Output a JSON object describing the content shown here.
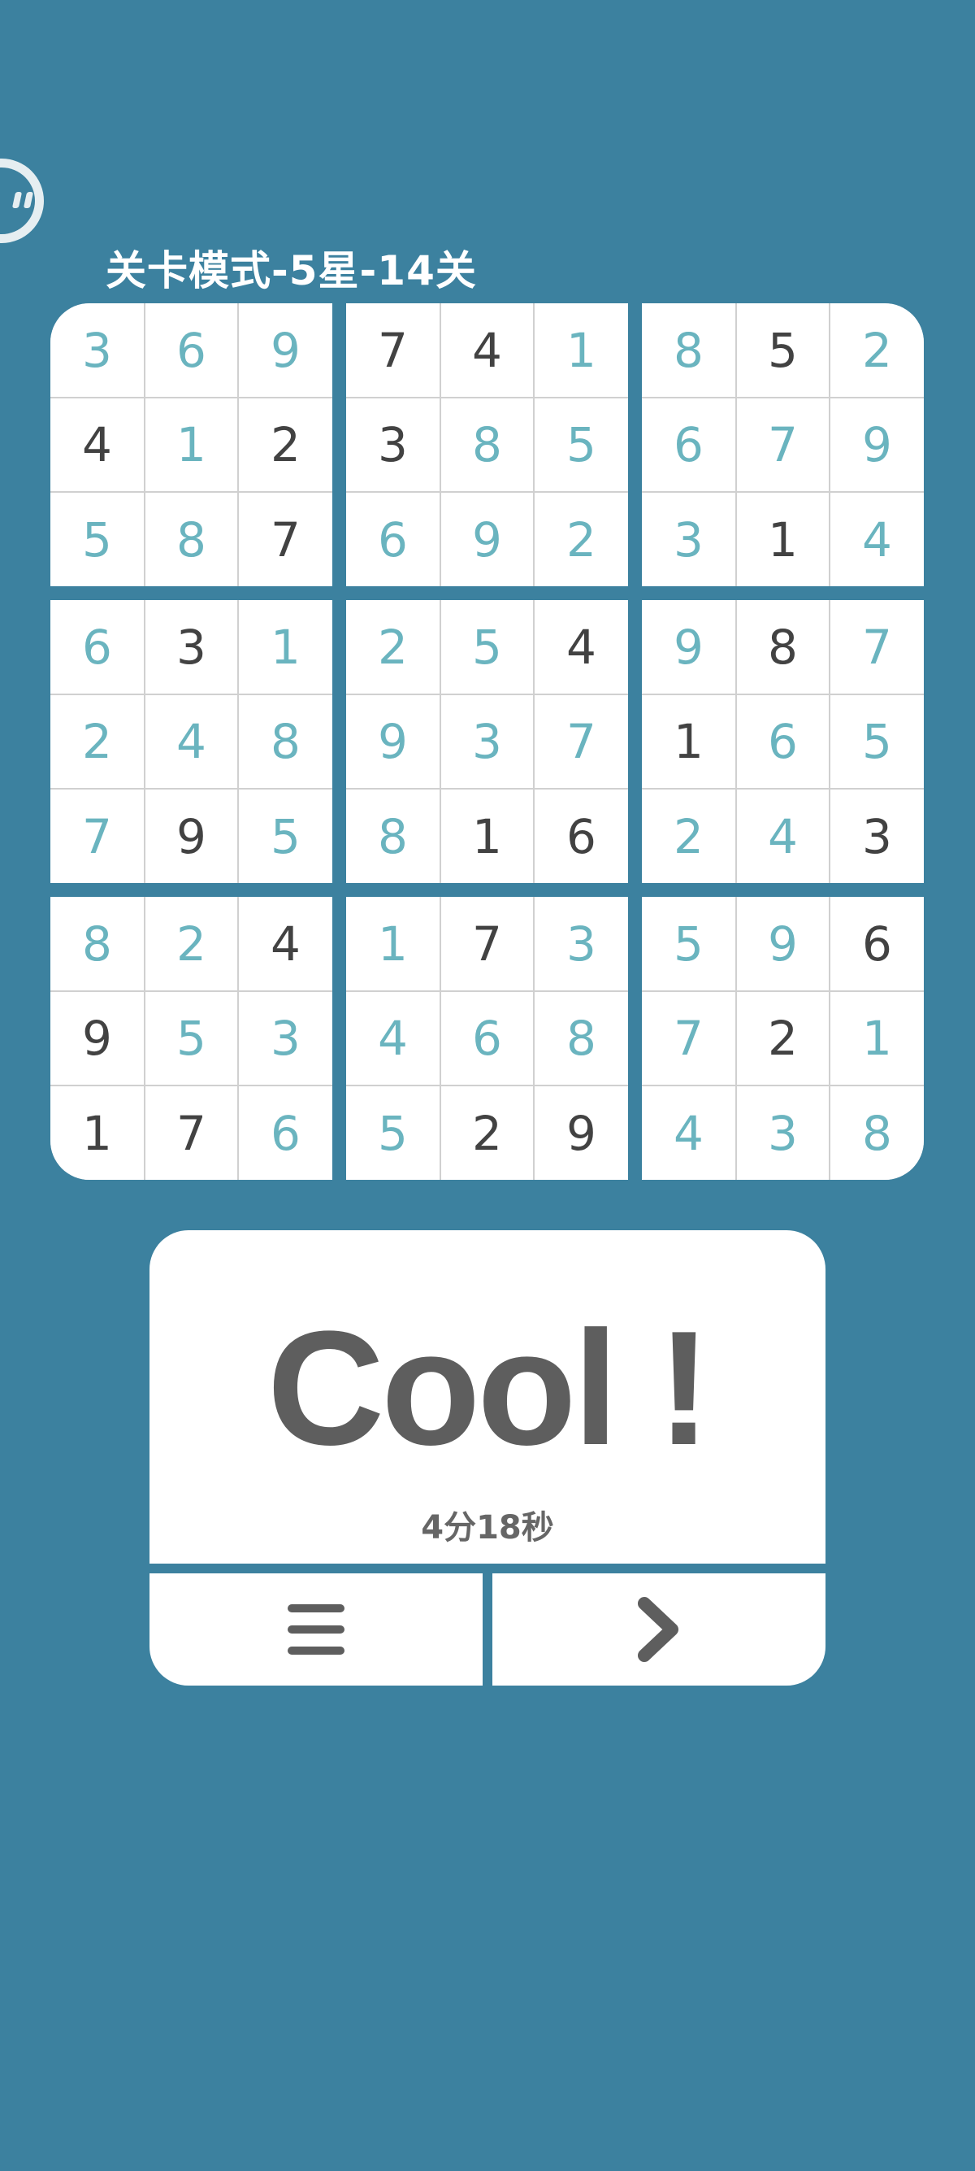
{
  "header": {
    "level_title": "关卡模式-5星-14关"
  },
  "board": {
    "rows": [
      [
        3,
        6,
        9,
        7,
        4,
        1,
        8,
        5,
        2
      ],
      [
        4,
        1,
        2,
        3,
        8,
        5,
        6,
        7,
        9
      ],
      [
        5,
        8,
        7,
        6,
        9,
        2,
        3,
        1,
        4
      ],
      [
        6,
        3,
        1,
        2,
        5,
        4,
        9,
        8,
        7
      ],
      [
        2,
        4,
        8,
        9,
        3,
        7,
        1,
        6,
        5
      ],
      [
        7,
        9,
        5,
        8,
        1,
        6,
        2,
        4,
        3
      ],
      [
        8,
        2,
        4,
        1,
        7,
        3,
        5,
        9,
        6
      ],
      [
        9,
        5,
        3,
        4,
        6,
        8,
        7,
        2,
        1
      ],
      [
        1,
        7,
        6,
        5,
        2,
        9,
        4,
        3,
        8
      ]
    ],
    "given": [
      [
        0,
        0,
        0,
        1,
        1,
        0,
        0,
        1,
        0
      ],
      [
        1,
        0,
        1,
        1,
        0,
        0,
        0,
        0,
        0
      ],
      [
        0,
        0,
        1,
        0,
        0,
        0,
        0,
        1,
        0
      ],
      [
        0,
        1,
        0,
        0,
        0,
        1,
        0,
        1,
        0
      ],
      [
        0,
        0,
        0,
        0,
        0,
        0,
        1,
        0,
        0
      ],
      [
        0,
        1,
        0,
        0,
        1,
        1,
        0,
        0,
        1
      ],
      [
        0,
        0,
        1,
        0,
        1,
        0,
        0,
        0,
        1
      ],
      [
        1,
        0,
        0,
        0,
        0,
        0,
        0,
        1,
        0
      ],
      [
        1,
        1,
        0,
        0,
        1,
        1,
        0,
        0,
        0
      ]
    ],
    "colors": {
      "given": "#424242",
      "filled": "#6ab4bf",
      "grid_line": "#d0d0d0",
      "background": "#3c819f"
    }
  },
  "result": {
    "message": "Cool !",
    "time": "4分18秒"
  },
  "buttons": {
    "menu_icon": "menu-icon",
    "next_icon": "chevron-right-icon"
  }
}
